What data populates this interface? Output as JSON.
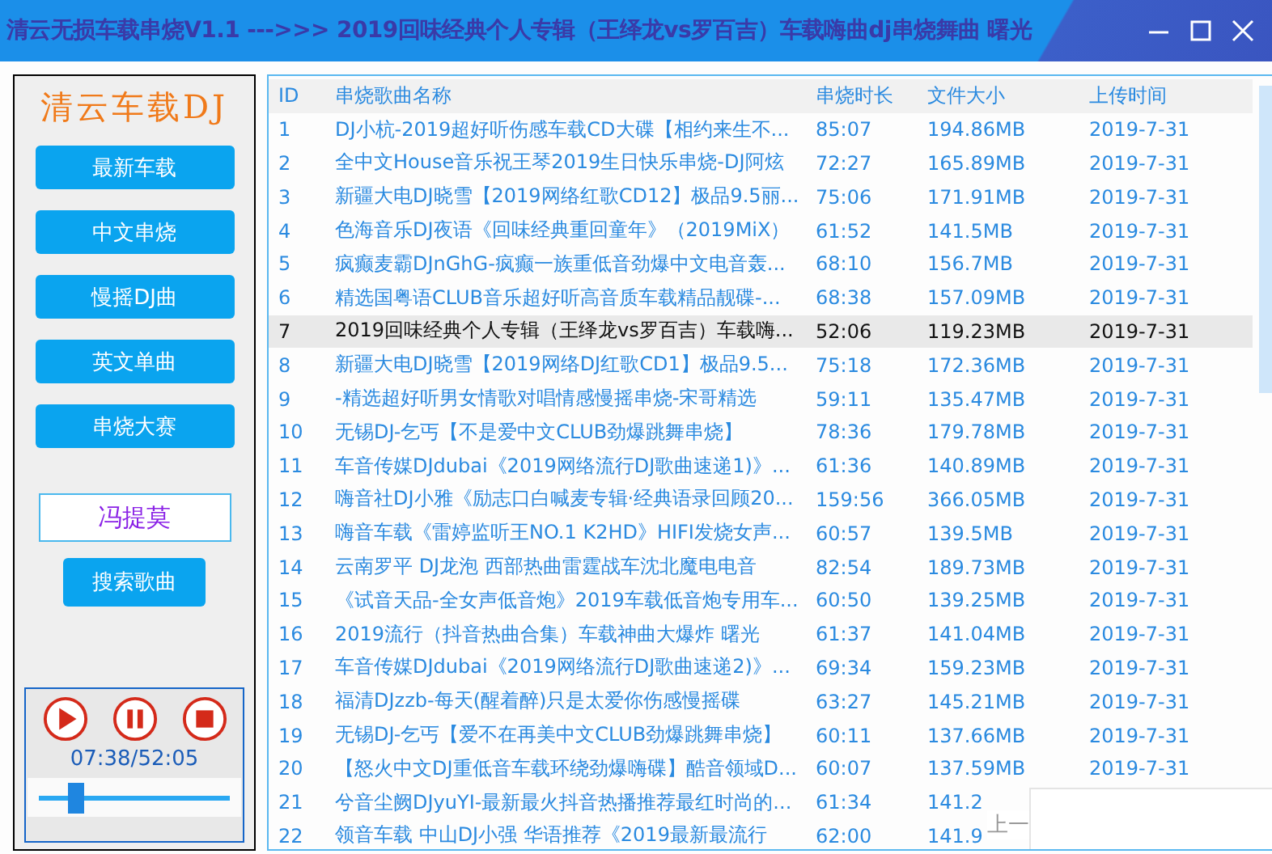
{
  "window": {
    "title": "清云无损车载串烧V1.1 --->>> 2019回味经典个人专辑（王绎龙vs罗百吉）车载嗨曲dj串烧舞曲 曙光"
  },
  "sidebar": {
    "logo": "清云车载DJ",
    "items": [
      {
        "label": "最新车载"
      },
      {
        "label": "中文串烧"
      },
      {
        "label": "慢摇DJ曲"
      },
      {
        "label": "英文单曲"
      },
      {
        "label": "串烧大赛"
      }
    ],
    "search": {
      "value": "冯提莫",
      "button": "搜索歌曲"
    },
    "player": {
      "time": "07:38/52:05",
      "level": 0.17
    }
  },
  "table": {
    "columns": [
      "ID",
      "串烧歌曲名称",
      "串烧时长",
      "文件大小",
      "上传时间"
    ],
    "rows": [
      {
        "id": "1",
        "name": "DJ小杭-2019超好听伤感车载CD大碟【相约来生不...",
        "duration": "85:07",
        "size": "194.86MB",
        "date": "2019-7-31",
        "selected": false
      },
      {
        "id": "2",
        "name": "全中文House音乐祝王琴2019生日快乐串烧-DJ阿炫",
        "duration": "72:27",
        "size": "165.89MB",
        "date": "2019-7-31",
        "selected": false
      },
      {
        "id": "3",
        "name": "新疆大电DJ晓雪【2019网络红歌CD12】极品9.5丽...",
        "duration": "75:06",
        "size": "171.91MB",
        "date": "2019-7-31",
        "selected": false
      },
      {
        "id": "4",
        "name": "色海音乐DJ夜语《回味经典重回童年》（2019MiX）",
        "duration": "61:52",
        "size": "141.5MB",
        "date": "2019-7-31",
        "selected": false
      },
      {
        "id": "5",
        "name": "疯癫麦霸DJnGhG-疯癫一族重低音劲爆中文电音轰...",
        "duration": "68:10",
        "size": "156.7MB",
        "date": "2019-7-31",
        "selected": false
      },
      {
        "id": "6",
        "name": "精选国粤语CLUB音乐超好听高音质车载精品靓碟-...",
        "duration": "68:38",
        "size": "157.09MB",
        "date": "2019-7-31",
        "selected": false
      },
      {
        "id": "7",
        "name": "2019回味经典个人专辑（王绎龙vs罗百吉）车载嗨...",
        "duration": "52:06",
        "size": "119.23MB",
        "date": "2019-7-31",
        "selected": true
      },
      {
        "id": "8",
        "name": "新疆大电DJ晓雪【2019网络DJ红歌CD1】极品9.5...",
        "duration": "75:18",
        "size": "172.36MB",
        "date": "2019-7-31",
        "selected": false
      },
      {
        "id": "9",
        "name": "-精选超好听男女情歌对唱情感慢摇串烧-宋哥精选",
        "duration": "59:11",
        "size": "135.47MB",
        "date": "2019-7-31",
        "selected": false
      },
      {
        "id": "10",
        "name": "无锡DJ-乞丐【不是爱中文CLUB劲爆跳舞串烧】",
        "duration": "78:36",
        "size": "179.78MB",
        "date": "2019-7-31",
        "selected": false
      },
      {
        "id": "11",
        "name": "车音传媒DJdubai《2019网络流行DJ歌曲速递1)》...",
        "duration": "61:36",
        "size": "140.89MB",
        "date": "2019-7-31",
        "selected": false
      },
      {
        "id": "12",
        "name": "嗨音社DJ小雅《励志口白喊麦专辑·经典语录回顾20...",
        "duration": "159:56",
        "size": "366.05MB",
        "date": "2019-7-31",
        "selected": false
      },
      {
        "id": "13",
        "name": "嗨音车载《雷婷监听王NO.1 K2HD》HIFI发烧女声...",
        "duration": "60:57",
        "size": "139.5MB",
        "date": "2019-7-31",
        "selected": false
      },
      {
        "id": "14",
        "name": "云南罗平 DJ龙泡 西部热曲雷霆战车沈北魔电电音",
        "duration": "82:54",
        "size": "189.73MB",
        "date": "2019-7-31",
        "selected": false
      },
      {
        "id": "15",
        "name": "《试音天品-全女声低音炮》2019车载低音炮专用车...",
        "duration": "60:50",
        "size": "139.25MB",
        "date": "2019-7-31",
        "selected": false
      },
      {
        "id": "16",
        "name": "2019流行（抖音热曲合集）车载神曲大爆炸 曙光",
        "duration": "61:37",
        "size": "141.04MB",
        "date": "2019-7-31",
        "selected": false
      },
      {
        "id": "17",
        "name": "车音传媒DJdubai《2019网络流行DJ歌曲速递2)》...",
        "duration": "69:34",
        "size": "159.23MB",
        "date": "2019-7-31",
        "selected": false
      },
      {
        "id": "18",
        "name": "福清DJzzb-每天(醒着醉)只是太爱你伤感慢摇碟",
        "duration": "63:27",
        "size": "145.21MB",
        "date": "2019-7-31",
        "selected": false
      },
      {
        "id": "19",
        "name": "无锡DJ-乞丐【爱不在再美中文CLUB劲爆跳舞串烧】",
        "duration": "60:11",
        "size": "137.66MB",
        "date": "2019-7-31",
        "selected": false
      },
      {
        "id": "20",
        "name": "【怒火中文DJ重低音车载环绕劲爆嗨碟】酷音领域D...",
        "duration": "60:07",
        "size": "137.59MB",
        "date": "2019-7-31",
        "selected": false
      },
      {
        "id": "21",
        "name": "兮音尘阙DJyuYI-最新最火抖音热播推荐最红时尚的...",
        "duration": "61:34",
        "size": "141.2",
        "date": "",
        "selected": false
      },
      {
        "id": "22",
        "name": "领音车载 中山DJ小强 华语推荐《2019最新最流行",
        "duration": "62:00",
        "size": "141.9",
        "date": "",
        "selected": false
      }
    ]
  },
  "overlay": {
    "text": "上一"
  }
}
